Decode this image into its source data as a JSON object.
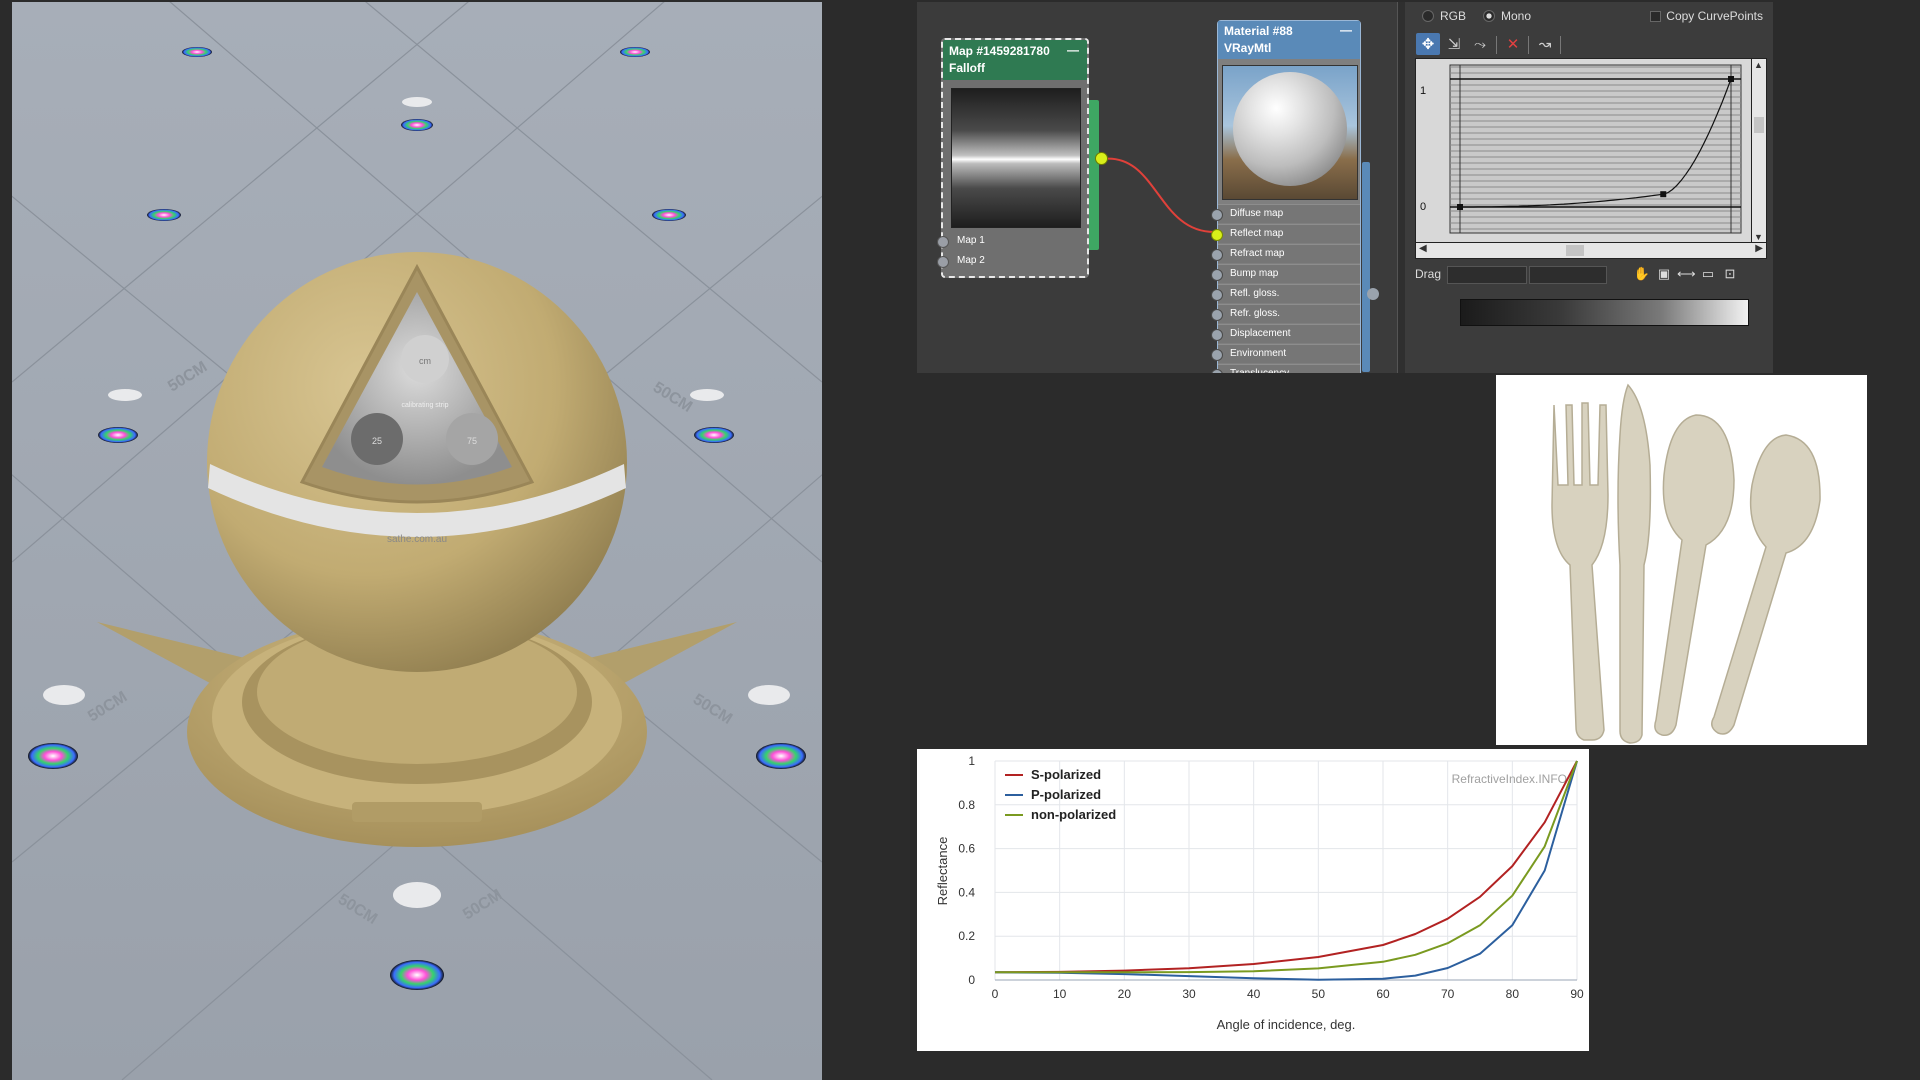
{
  "render": {
    "floor_label": "50CM",
    "band_text": "sathe.com.au",
    "badge_top": "cm",
    "badge_left": "25",
    "badge_right": "75",
    "badge_center": "calibrating strip"
  },
  "slate": {
    "falloff_node": {
      "title_line1": "Map #1459281780",
      "title_line2": "Falloff",
      "minimize": "—",
      "slots": [
        "Map 1",
        "Map 2"
      ]
    },
    "material_node": {
      "title_line1": "Material #88",
      "title_line2": "VRayMtl",
      "minimize": "—",
      "active_slot": "Reflect map",
      "slots": [
        "Diffuse map",
        "Reflect map",
        "Refract map",
        "Bump map",
        "Refl. gloss.",
        "Refr. gloss.",
        "Displacement",
        "Environment",
        "Translucency"
      ]
    }
  },
  "curve_editor": {
    "mode_rgb": "RGB",
    "mode_mono": "Mono",
    "selected_mode": "Mono",
    "copy_curvepoints": "Copy CurvePoints",
    "toolbar_icons": [
      "move-icon",
      "scale-point-icon",
      "insert-point-icon",
      "delete-point-icon",
      "reset-curve-icon"
    ],
    "y_tick_top": "1",
    "y_tick_bottom": "0",
    "drag_label": "Drag",
    "curve_points": [
      [
        0.0,
        0.0
      ],
      [
        0.75,
        0.1
      ],
      [
        1.0,
        1.0
      ]
    ],
    "nav_icons": [
      "pan-hand-icon",
      "zoom-extents-icon",
      "zoom-horizontal-icon",
      "zoom-vertical-icon",
      "region-zoom-icon"
    ]
  },
  "chart": {
    "watermark": "RefractiveIndex.INFO",
    "chart_data": {
      "type": "line",
      "xlabel": "Angle of incidence, deg.",
      "ylabel": "Reflectance",
      "xlim": [
        0,
        90
      ],
      "ylim": [
        0,
        1
      ],
      "x_ticks": [
        "0",
        "10",
        "20",
        "30",
        "40",
        "50",
        "60",
        "70",
        "80",
        "90"
      ],
      "y_ticks": [
        "0",
        "0.2",
        "0.4",
        "0.6",
        "0.8",
        "1"
      ],
      "grid": true,
      "legend_position": "top-left",
      "x": [
        0,
        10,
        20,
        30,
        40,
        50,
        60,
        65,
        70,
        75,
        80,
        85,
        90
      ],
      "series": [
        {
          "name": "S-polarized",
          "color": "#b22222",
          "values": [
            0.035,
            0.037,
            0.043,
            0.054,
            0.073,
            0.105,
            0.16,
            0.21,
            0.28,
            0.38,
            0.52,
            0.72,
            1.0
          ]
        },
        {
          "name": "P-polarized",
          "color": "#2c5f9e",
          "values": [
            0.035,
            0.033,
            0.027,
            0.018,
            0.008,
            0.001,
            0.006,
            0.02,
            0.055,
            0.12,
            0.25,
            0.5,
            1.0
          ]
        },
        {
          "name": "non-polarized",
          "color": "#7a9a20",
          "values": [
            0.035,
            0.035,
            0.035,
            0.036,
            0.04,
            0.053,
            0.083,
            0.115,
            0.168,
            0.25,
            0.385,
            0.61,
            1.0
          ]
        }
      ]
    }
  }
}
